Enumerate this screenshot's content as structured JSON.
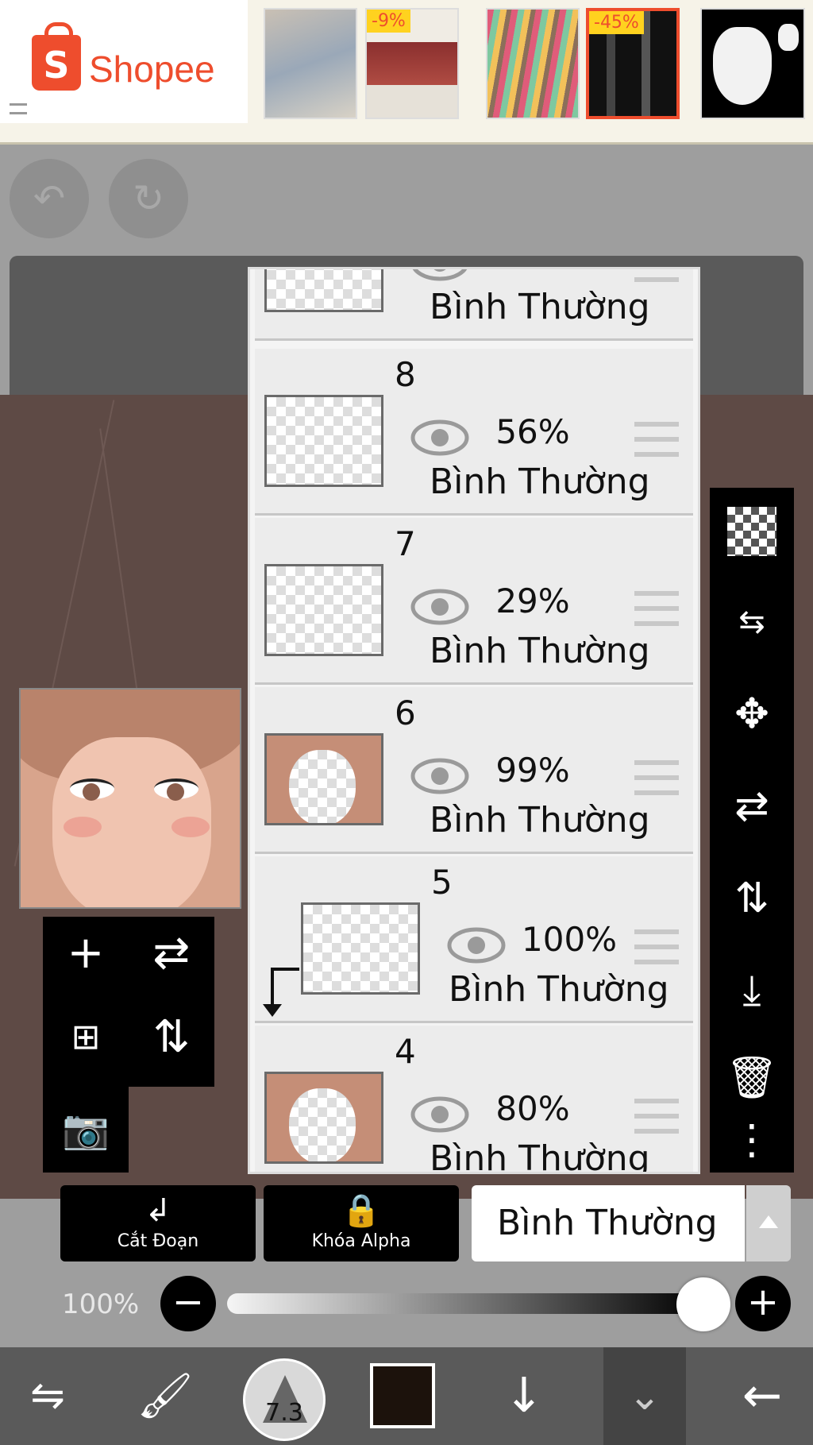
{
  "ad": {
    "brand": "Shopee",
    "products": [
      {
        "badge": ""
      },
      {
        "badge": "-9%"
      },
      {
        "badge": ""
      },
      {
        "badge": "-45%"
      },
      {
        "badge": ""
      }
    ]
  },
  "history": {
    "undo_icon": "undo-icon",
    "redo_icon": "redo-icon"
  },
  "layers": [
    {
      "number": "",
      "opacity": "",
      "blend": "Bình Thường",
      "clipped": false
    },
    {
      "number": "8",
      "opacity": "56%",
      "blend": "Bình Thường",
      "clipped": false
    },
    {
      "number": "7",
      "opacity": "29%",
      "blend": "Bình Thường",
      "clipped": false
    },
    {
      "number": "6",
      "opacity": "99%",
      "blend": "Bình Thường",
      "clipped": false
    },
    {
      "number": "5",
      "opacity": "100%",
      "blend": "Bình Thường",
      "clipped": true
    },
    {
      "number": "4",
      "opacity": "80%",
      "blend": "Bình Thường",
      "clipped": false
    }
  ],
  "actions": {
    "clip_label": "Cắt Đoạn",
    "alpha_label": "Khóa Alpha",
    "blend_mode": "Bình Thường"
  },
  "opacity": {
    "label": "100%",
    "value": 1.0
  },
  "bottom_bar": {
    "brush_size": "7.3",
    "color": "#1c120c"
  },
  "colors": {
    "accent": "#ee4d2d",
    "toolbar": "#000000"
  }
}
